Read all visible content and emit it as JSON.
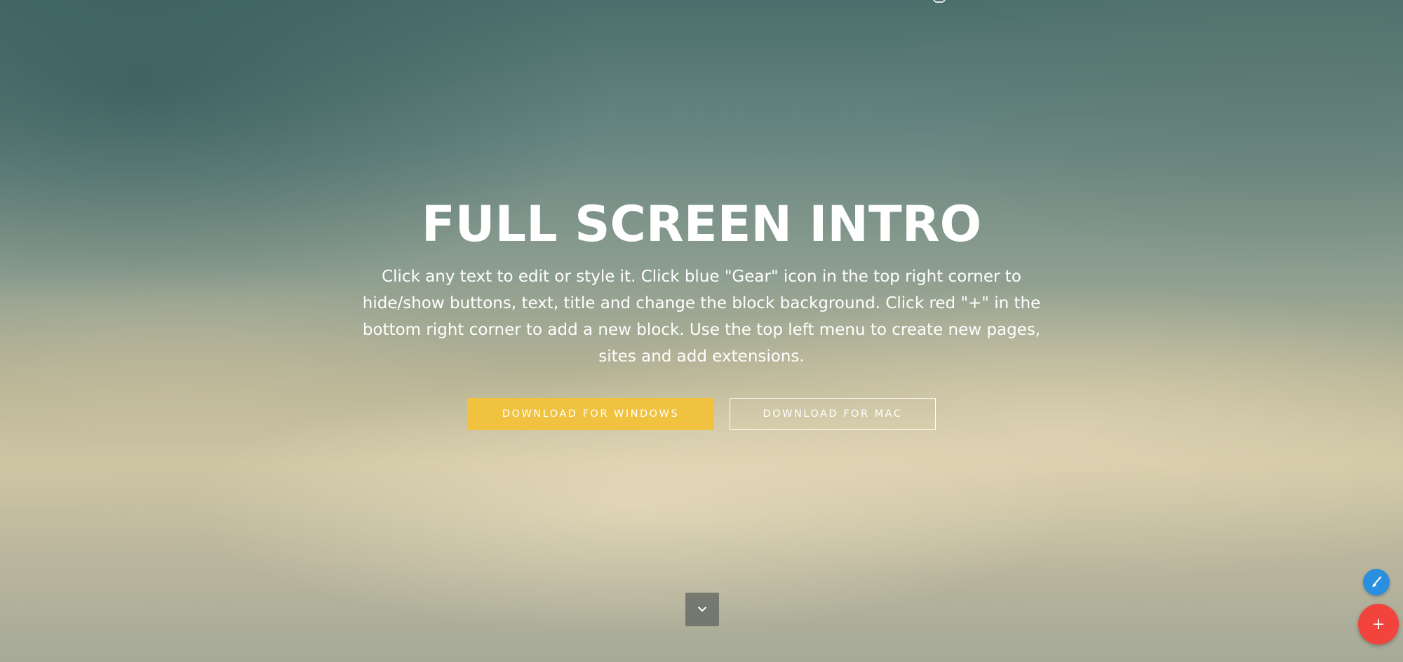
{
  "hero": {
    "title": "FULL SCREEN INTRO",
    "subtitle": "Click any text to edit or style it. Click blue \"Gear\" icon in the top right corner to hide/show buttons, text, title and change the block background. Click red \"+\" in the bottom right corner to add a new block. Use the top left menu to create new pages, sites and add extensions.",
    "primary_button": "DOWNLOAD FOR WINDOWS",
    "secondary_button": "DOWNLOAD FOR MAC"
  },
  "controls": {
    "scroll_down_icon": "chevron-down-icon",
    "edit_icon": "brush-icon",
    "add_icon": "plus-icon"
  },
  "colors": {
    "primary_button_bg": "#f0c23f",
    "edit_fab_bg": "#2b8fe0",
    "add_fab_bg": "#f2433c"
  }
}
